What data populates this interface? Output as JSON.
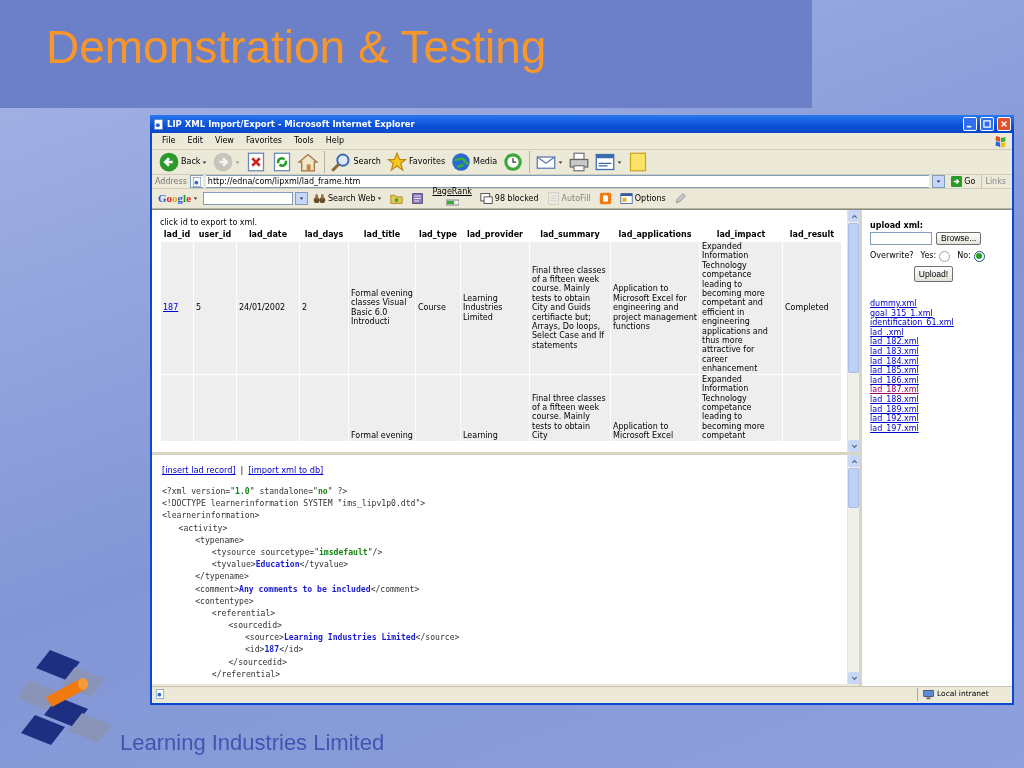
{
  "slide": {
    "title": "Demonstration & Testing",
    "footer": "Learning Industries Limited"
  },
  "window": {
    "title": "LIP XML Import/Export - Microsoft Internet Explorer",
    "menu": [
      "File",
      "Edit",
      "View",
      "Favorites",
      "Tools",
      "Help"
    ],
    "toolbar": [
      {
        "label": "Back",
        "dropdown": true,
        "disabled": false,
        "separator_before": false
      },
      {
        "dropdown": true,
        "disabled": true,
        "separator_before": false
      },
      {
        "dropdown": false,
        "disabled": false,
        "separator_before": false
      },
      {
        "dropdown": false,
        "disabled": false,
        "separator_before": false
      },
      {
        "dropdown": false,
        "disabled": false,
        "separator_before": false
      },
      {
        "label": "Search",
        "dropdown": false,
        "disabled": false,
        "separator_before": true
      },
      {
        "label": "Favorites",
        "dropdown": false,
        "disabled": false,
        "separator_before": false
      },
      {
        "label": "Media",
        "dropdown": false,
        "disabled": false,
        "separator_before": false
      },
      {
        "dropdown": false,
        "disabled": false,
        "separator_before": false
      },
      {
        "dropdown": true,
        "disabled": false,
        "separator_before": true
      },
      {
        "dropdown": false,
        "disabled": false,
        "separator_before": false
      },
      {
        "dropdown": true,
        "disabled": false,
        "separator_before": false
      },
      {
        "dropdown": false,
        "disabled": false,
        "separator_before": false
      }
    ],
    "address": {
      "label": "Address",
      "url": "http://edna/com/lipxml/lad_frame.htm",
      "go": "Go",
      "links": "Links"
    },
    "google_bar": {
      "logo": "Google",
      "items": [
        {
          "label": "Search Web",
          "dropdown": true,
          "disabled": false,
          "separator_before": false
        },
        {
          "dropdown": false,
          "disabled": false,
          "separator_before": false
        },
        {
          "dropdown": false,
          "disabled": false,
          "separator_before": false
        },
        {
          "label": "PageRank",
          "dropdown": false,
          "disabled": false,
          "separator_before": false
        },
        {
          "label": "98 blocked",
          "dropdown": false,
          "disabled": false,
          "separator_before": false
        },
        {
          "label": "AutoFill",
          "dropdown": false,
          "disabled": true,
          "separator_before": false
        },
        {
          "dropdown": false,
          "disabled": false,
          "separator_before": false
        },
        {
          "label": "Options",
          "dropdown": false,
          "disabled": false,
          "separator_before": false
        },
        {
          "dropdown": false,
          "disabled": false,
          "separator_before": false
        }
      ]
    },
    "table_frame": {
      "note": "click id to export to xml.",
      "columns": [
        "lad_id",
        "user_id",
        "lad_date",
        "lad_days",
        "lad_title",
        "lad_type",
        "lad_provider",
        "lad_summary",
        "lad_applications",
        "lad_impact",
        "lad_result"
      ],
      "rows": [
        {
          "cells": {
            "lad_id": "187",
            "user_id": "5",
            "lad_date": "24/01/2002",
            "lad_days": "2",
            "lad_title": "Formal evening classes Visual Basic 6.0 Introducti",
            "lad_type": "Course",
            "lad_provider": "Learning Industries Limited",
            "lad_summary": "Final three classes of a fifteen week course. Mainly tests to obtain City and Guids certifiacte but; Arrays, Do loops, Select Case and If statements",
            "lad_applications": "Application to Microsoft Excel for engineering and project management functions",
            "lad_impact": "Expanded Information Technology competance leading to becoming more competant and efficient in engineering applications and thus more attractive for career enhancement",
            "lad_result": "Completed"
          }
        },
        {
          "cells": {
            "lad_title": "Formal evening",
            "lad_provider": "Learning",
            "lad_summary": "Final three classes of a fifteen week course. Mainly tests to obtain City",
            "lad_applications": "Application to Microsoft Excel",
            "lad_impact": "Expanded Information Technology competance leading to becoming more competant"
          }
        }
      ]
    },
    "upload_frame": {
      "label": "upload xml:",
      "browse": "Browse...",
      "overwrite": "Overwrite?",
      "options": [
        {
          "label": "Yes:",
          "selected": false
        },
        {
          "label": "No:",
          "selected": true
        }
      ],
      "button": "Upload!",
      "files": [
        {
          "name": "dummy.xml",
          "visited": false
        },
        {
          "name": "goal_315_1.xml",
          "visited": false
        },
        {
          "name": "identification_61.xml",
          "visited": false
        },
        {
          "name": "lad_.xml",
          "visited": false
        },
        {
          "name": "lad_182.xml",
          "visited": false
        },
        {
          "name": "lad_183.xml",
          "visited": false
        },
        {
          "name": "lad_184.xml",
          "visited": false
        },
        {
          "name": "lad_185.xml",
          "visited": false
        },
        {
          "name": "lad_186.xml",
          "visited": false
        },
        {
          "name": "lad_187.xml",
          "visited": true
        },
        {
          "name": "lad_188.xml",
          "visited": false
        },
        {
          "name": "lad_189.xml",
          "visited": false
        },
        {
          "name": "lad_192.xml",
          "visited": false
        },
        {
          "name": "lad_197.xml",
          "visited": false
        }
      ]
    },
    "xml_frame": {
      "links": [
        "[insert lad record]",
        "[import xml to db]"
      ],
      "link_separator": "|",
      "lines": [
        {
          "parts": [
            {
              "text": "<?xml version=\""
            },
            {
              "text": "1.0",
              "kind": "value"
            },
            {
              "text": "\" standalone=\""
            },
            {
              "text": "no",
              "kind": "value"
            },
            {
              "text": "\" ?>"
            }
          ]
        },
        {
          "parts": [
            {
              "text": "<!DOCTYPE learnerinformation SYSTEM \"ims_lipv1p0.dtd\">"
            }
          ]
        },
        {
          "parts": [
            {
              "text": "<learnerinformation>"
            }
          ],
          "children": [
            {
              "parts": [
                {
                  "text": "<activity>"
                }
              ],
              "children": [
                {
                  "parts": [
                    {
                      "text": "<typename>"
                    }
                  ],
                  "children": [
                    {
                      "parts": [
                        {
                          "text": "<tysource sourcetype=\""
                        },
                        {
                          "text": "imsdefault",
                          "kind": "value"
                        },
                        {
                          "text": "\"/>"
                        }
                      ]
                    },
                    {
                      "parts": [
                        {
                          "text": "<tyvalue>"
                        },
                        {
                          "text": "Education",
                          "kind": "content"
                        },
                        {
                          "text": "</tyvalue>"
                        }
                      ]
                    }
                  ]
                },
                {
                  "parts": [
                    {
                      "text": "</typename>"
                    }
                  ]
                },
                {
                  "parts": [
                    {
                      "text": "<comment>"
                    },
                    {
                      "text": "Any comments to be included",
                      "kind": "content"
                    },
                    {
                      "text": "</comment>"
                    }
                  ]
                },
                {
                  "parts": [
                    {
                      "text": "<contentype>"
                    }
                  ],
                  "children": [
                    {
                      "parts": [
                        {
                          "text": "<referential>"
                        }
                      ],
                      "children": [
                        {
                          "parts": [
                            {
                              "text": "<sourcedid>"
                            }
                          ],
                          "children": [
                            {
                              "parts": [
                                {
                                  "text": "<source>"
                                },
                                {
                                  "text": "Learning Industries Limited",
                                  "kind": "content"
                                },
                                {
                                  "text": "</source>"
                                }
                              ]
                            },
                            {
                              "parts": [
                                {
                                  "text": "<id>"
                                },
                                {
                                  "text": "187",
                                  "kind": "content"
                                },
                                {
                                  "text": "</id>"
                                }
                              ]
                            }
                          ]
                        },
                        {
                          "parts": [
                            {
                              "text": "</sourcedid>"
                            }
                          ]
                        }
                      ]
                    },
                    {
                      "parts": [
                        {
                          "text": "</referential>"
                        }
                      ]
                    }
                  ]
                }
              ]
            }
          ]
        }
      ]
    },
    "status_bar": {
      "zone": "Local intranet"
    }
  }
}
